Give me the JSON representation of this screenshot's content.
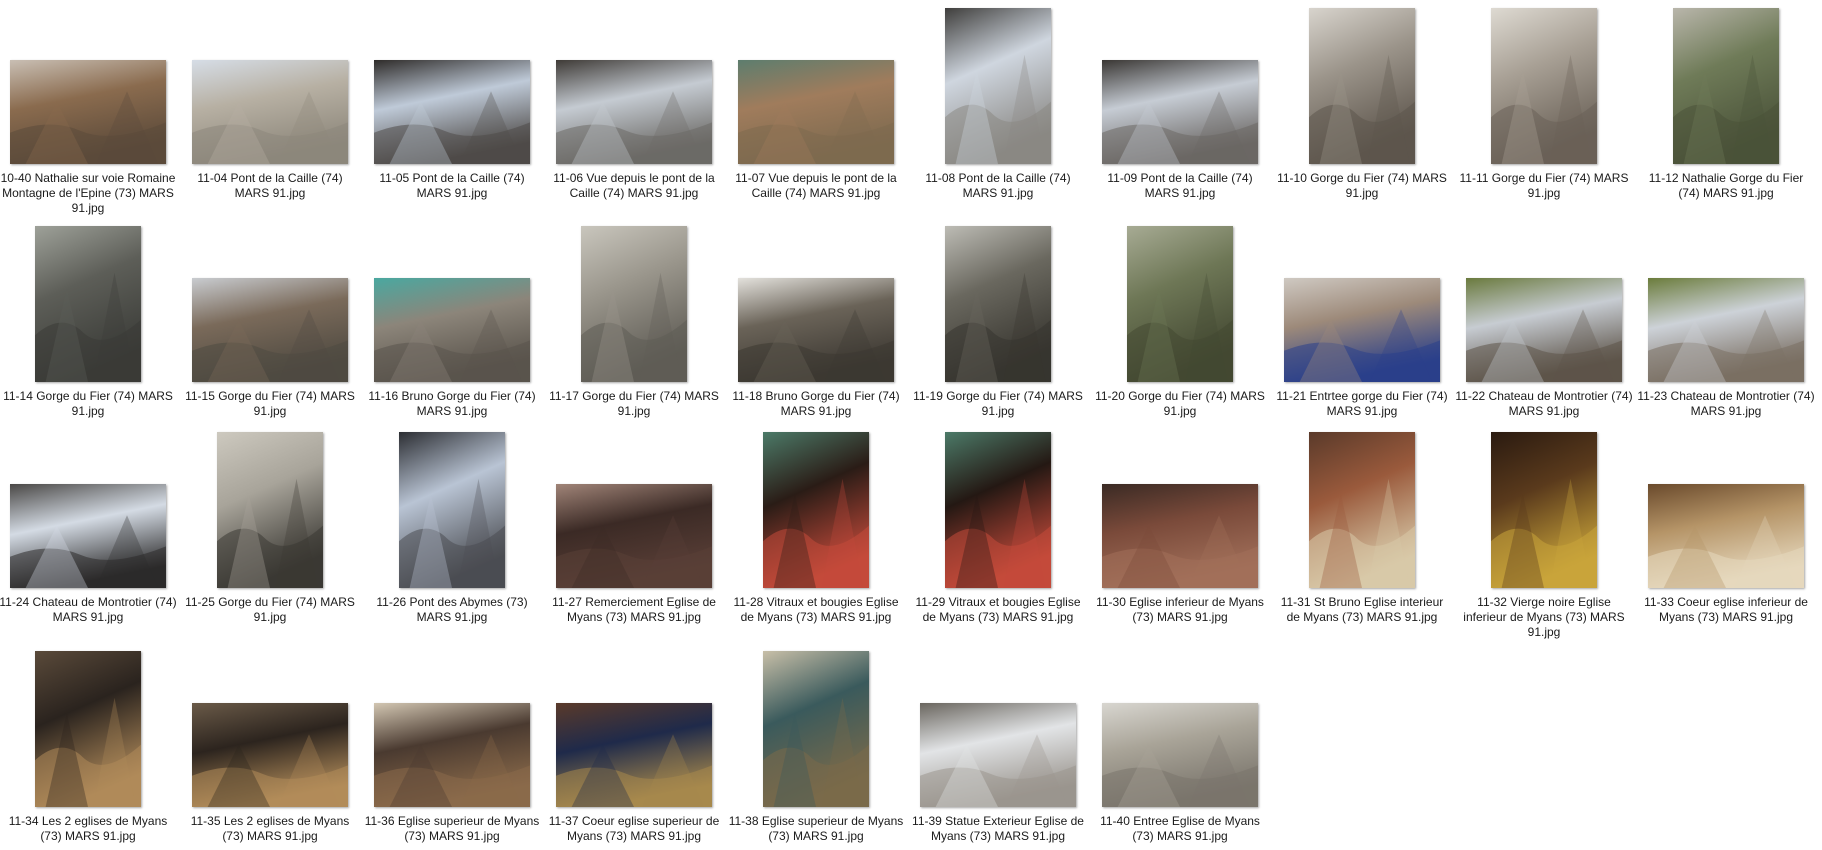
{
  "files": [
    {
      "name": "10-40 Nathalie sur voie Romaine Montagne de l'Epine (73) MARS 91.jpg",
      "orient": "land",
      "colors": [
        "#8a6b4e",
        "#5b4a3a",
        "#c9bfb4"
      ]
    },
    {
      "name": "11-04 Pont de la Caille (74) MARS 91.jpg",
      "orient": "land",
      "colors": [
        "#b7b0a3",
        "#8d877b",
        "#d6dde6"
      ]
    },
    {
      "name": "11-05 Pont de la Caille (74) MARS 91.jpg",
      "orient": "land",
      "colors": [
        "#bfcad8",
        "#4f4b48",
        "#2f2c2a"
      ]
    },
    {
      "name": "11-06 Vue depuis le pont de la Caille (74) MARS 91.jpg",
      "orient": "land",
      "colors": [
        "#c5cbd2",
        "#6c6a66",
        "#3f3b37"
      ]
    },
    {
      "name": "11-07 Vue depuis le pont de la Caille (74) MARS 91.jpg",
      "orient": "land",
      "colors": [
        "#a07c5c",
        "#7d6a4f",
        "#5d7d6e"
      ]
    },
    {
      "name": "11-08 Pont de la Caille (74) MARS 91.jpg",
      "orient": "port",
      "colors": [
        "#cfd6df",
        "#8a8884",
        "#3f3e3c"
      ]
    },
    {
      "name": "11-09 Pont de la Caille (74) MARS 91.jpg",
      "orient": "land",
      "colors": [
        "#c6ccd4",
        "#6b6764",
        "#3a3734"
      ]
    },
    {
      "name": "11-10 Gorge du Fier (74) MARS 91.jpg",
      "orient": "port",
      "colors": [
        "#9b948a",
        "#5d554c",
        "#d8d4cd"
      ]
    },
    {
      "name": "11-11 Gorge du Fier (74) MARS 91.jpg",
      "orient": "port",
      "colors": [
        "#a8a095",
        "#6a6157",
        "#dedad2"
      ]
    },
    {
      "name": "11-12 Nathalie Gorge du Fier (74) MARS 91.jpg",
      "orient": "port",
      "colors": [
        "#6f7b58",
        "#4a5239",
        "#b9b6ab"
      ]
    },
    {
      "name": "11-14 Gorge du Fier (74) MARS 91.jpg",
      "orient": "port",
      "colors": [
        "#5d5e58",
        "#3a3b37",
        "#9ea199"
      ]
    },
    {
      "name": "11-15 Gorge du Fier (74) MARS 91.jpg",
      "orient": "land",
      "colors": [
        "#7a6a5a",
        "#4f4a41",
        "#c9ccd0"
      ]
    },
    {
      "name": "11-16 Bruno Gorge du Fier (74) MARS 91.jpg",
      "orient": "land",
      "colors": [
        "#8c857a",
        "#5a544c",
        "#4aa8a0"
      ]
    },
    {
      "name": "11-17 Gorge du Fier (74) MARS 91.jpg",
      "orient": "port",
      "colors": [
        "#9a968c",
        "#5f5c55",
        "#c9c6bd"
      ]
    },
    {
      "name": "11-18 Bruno Gorge du Fier (74) MARS 91.jpg",
      "orient": "land",
      "colors": [
        "#6a6358",
        "#3c3832",
        "#e3e1dc"
      ]
    },
    {
      "name": "11-19 Gorge du Fier (74) MARS 91.jpg",
      "orient": "port",
      "colors": [
        "#6a685f",
        "#37352f",
        "#bdbcb5"
      ]
    },
    {
      "name": "11-20 Gorge du Fier (74) MARS 91.jpg",
      "orient": "port",
      "colors": [
        "#6e7756",
        "#434832",
        "#a7ab94"
      ]
    },
    {
      "name": "11-21 Entrtee gorge du Fier (74) MARS 91.jpg",
      "orient": "land",
      "colors": [
        "#9d8a7a",
        "#2a3f8a",
        "#cfc9c2"
      ]
    },
    {
      "name": "11-22 Chateau de Montrotier (74) MARS 91.jpg",
      "orient": "land",
      "colors": [
        "#c7ccd2",
        "#5d5449",
        "#6a7a3e"
      ]
    },
    {
      "name": "11-23 Chateau de Montrotier (74) MARS 91.jpg",
      "orient": "land",
      "colors": [
        "#cdd2d8",
        "#7a6f63",
        "#6b7c3c"
      ]
    },
    {
      "name": "11-24 Chateau de Montrotier (74) MARS 91.jpg",
      "orient": "land",
      "colors": [
        "#d4dbe4",
        "#2b2a2a",
        "#4a4846"
      ]
    },
    {
      "name": "11-25 Gorge du Fier (74) MARS 91.jpg",
      "orient": "port",
      "colors": [
        "#a8a49a",
        "#3a3833",
        "#cdc9bf"
      ]
    },
    {
      "name": "11-26 Pont des Abymes (73) MARS 91.jpg",
      "orient": "port",
      "colors": [
        "#b9c4d4",
        "#4b4d52",
        "#2c2e33"
      ]
    },
    {
      "name": "11-27 Remerciement Eglise de Myans (73) MARS 91.jpg",
      "orient": "land",
      "colors": [
        "#3b2a25",
        "#5a3f37",
        "#a08478"
      ]
    },
    {
      "name": "11-28 Vitraux et bougies Eglise de Myans (73) MARS 91.jpg",
      "orient": "port",
      "colors": [
        "#2a1c16",
        "#c44a3a",
        "#4c7a68"
      ]
    },
    {
      "name": "11-29 Vitraux et bougies Eglise de Myans (73) MARS 91.jpg",
      "orient": "port",
      "colors": [
        "#241813",
        "#c44a3a",
        "#4c7a68"
      ]
    },
    {
      "name": "11-30 Eglise inferieur de Myans (73) MARS 91.jpg",
      "orient": "land",
      "colors": [
        "#7a4a3a",
        "#a2705a",
        "#3a2a24"
      ]
    },
    {
      "name": "11-31 St Bruno Eglise interieur de Myans (73) MARS 91.jpg",
      "orient": "port",
      "colors": [
        "#9a5a3c",
        "#d8c9a8",
        "#5a3a2a"
      ]
    },
    {
      "name": "11-32 Vierge noire Eglise inferieur  de Myans (73) MARS 91.jpg",
      "orient": "port",
      "colors": [
        "#5a3a1c",
        "#c9a43a",
        "#2a1a10"
      ]
    },
    {
      "name": "11-33 Coeur eglise inferieur  de Myans (73) MARS 91.jpg",
      "orient": "land",
      "colors": [
        "#b59467",
        "#e6d8bd",
        "#6a4a2c"
      ]
    },
    {
      "name": "11-34 Les 2 eglises de Myans (73) MARS 91.jpg",
      "orient": "port",
      "colors": [
        "#2a231e",
        "#b08a5a",
        "#5a4a3a"
      ]
    },
    {
      "name": "11-35 Les 2 eglises de Myans (73) MARS 91.jpg",
      "orient": "land",
      "colors": [
        "#2c241e",
        "#b28c5a",
        "#6a5a48"
      ]
    },
    {
      "name": "11-36 Eglise superieur de Myans (73) MARS 91.jpg",
      "orient": "land",
      "colors": [
        "#4a3a30",
        "#8a6a4a",
        "#d2c6b2"
      ]
    },
    {
      "name": "11-37 Coeur eglise superieur de Myans (73) MARS 91.jpg",
      "orient": "land",
      "colors": [
        "#1f2a4a",
        "#a7894c",
        "#5a3a2a"
      ]
    },
    {
      "name": "11-38 Eglise superieur de Myans (73) MARS 91.jpg",
      "orient": "port",
      "colors": [
        "#3a5a5c",
        "#7a6a4a",
        "#c8bfa8"
      ]
    },
    {
      "name": "11-39 Statue Exterieur Eglise de Myans (73) MARS 91.jpg",
      "orient": "land",
      "colors": [
        "#e2e4e6",
        "#9a958e",
        "#6a665f"
      ]
    },
    {
      "name": "11-40 Entree Eglise de Myans (73) MARS 91.jpg",
      "orient": "land",
      "colors": [
        "#a9a498",
        "#7a756c",
        "#d8d6d0"
      ]
    }
  ]
}
